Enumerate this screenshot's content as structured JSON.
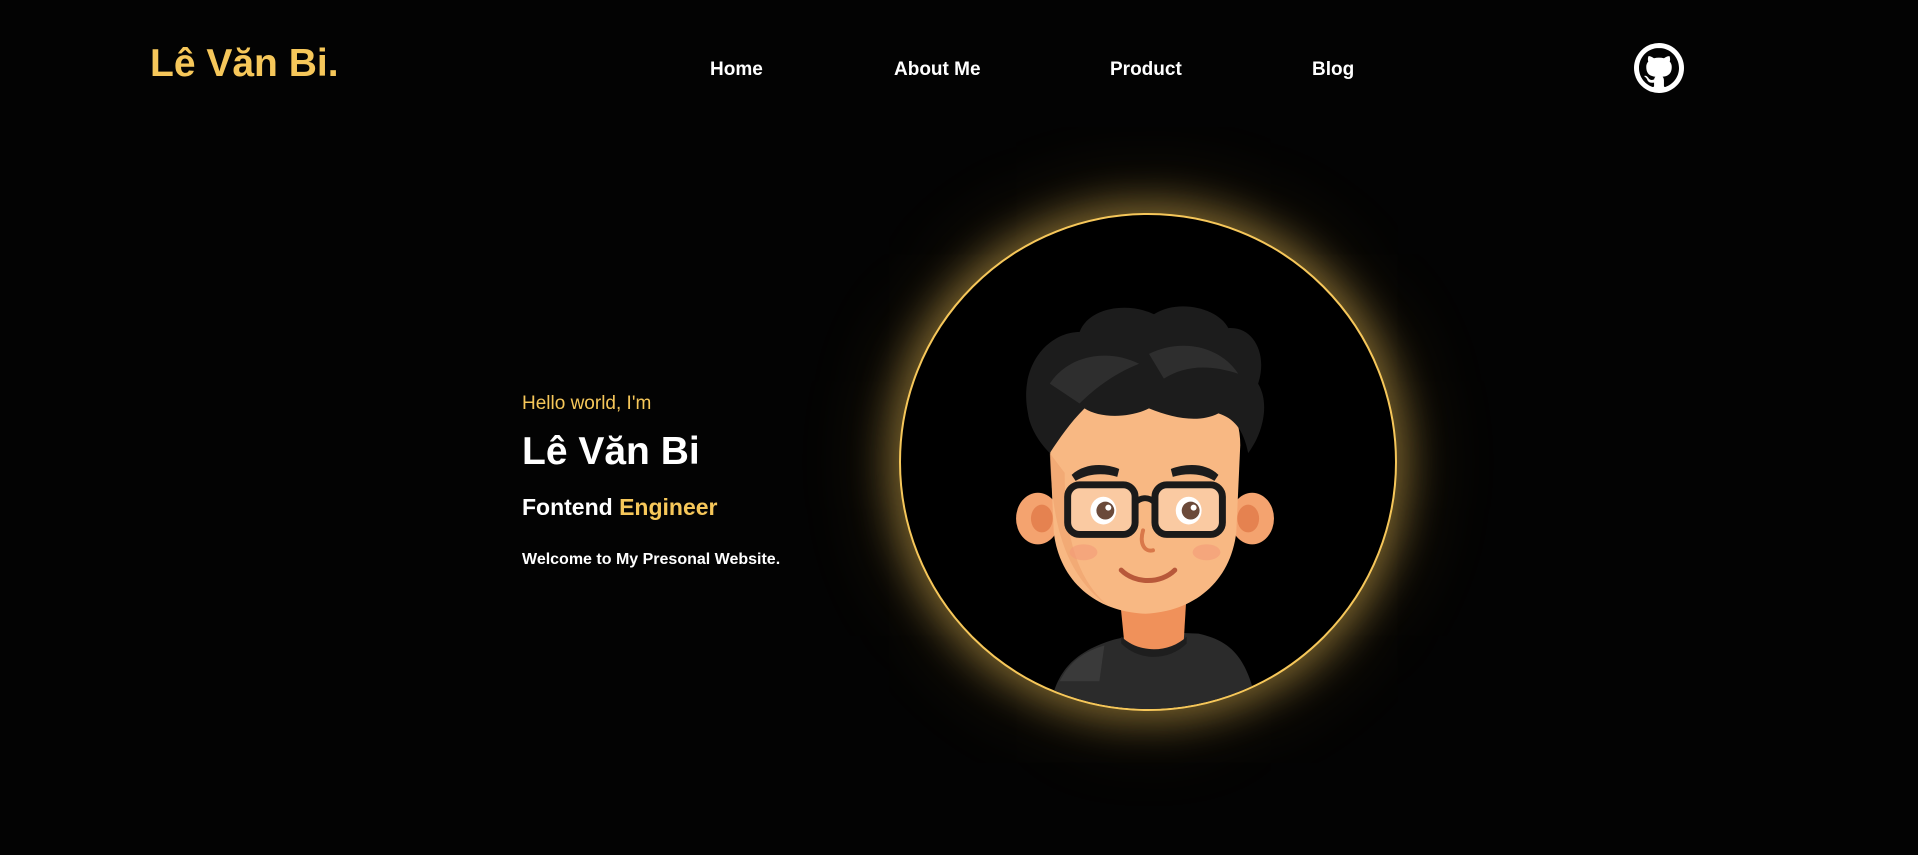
{
  "brand": {
    "logo_text": "Lê Văn Bi."
  },
  "nav": {
    "items": [
      {
        "label": "Home"
      },
      {
        "label": "About Me"
      },
      {
        "label": "Product"
      },
      {
        "label": "Blog"
      }
    ]
  },
  "header": {
    "github_icon": "github-icon"
  },
  "hero": {
    "greeting": "Hello world, I'm",
    "name": "Lê Văn Bi",
    "role_prefix": "Fontend",
    "role_accent": "Engineer",
    "welcome": "Welcome to My Presonal Website."
  },
  "avatar": {
    "icon": "cartoon-avatar"
  },
  "colors": {
    "background": "#030303",
    "accent": "#f6c75a",
    "text": "#ffffff"
  }
}
